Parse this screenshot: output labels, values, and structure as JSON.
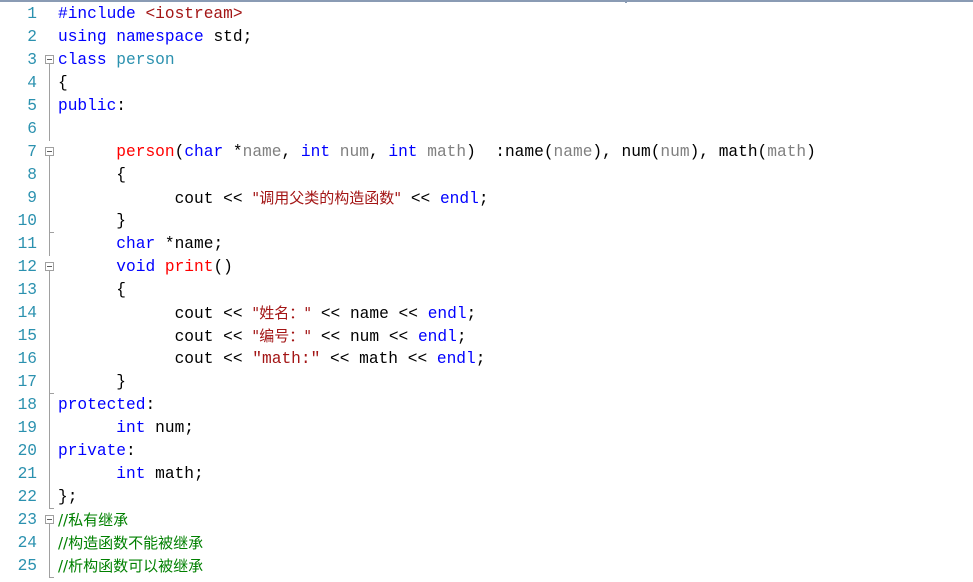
{
  "editor": {
    "lines": [
      {
        "n": "1",
        "tokens": [
          {
            "t": "#include ",
            "c": "kw"
          },
          {
            "t": "<iostream>",
            "c": "pp"
          }
        ]
      },
      {
        "n": "2",
        "tokens": [
          {
            "t": "using namespace ",
            "c": "kw"
          },
          {
            "t": "std;",
            "c": ""
          }
        ]
      },
      {
        "n": "3",
        "fold": "open",
        "tokens": [
          {
            "t": "class ",
            "c": "kw"
          },
          {
            "t": "person",
            "c": "ty"
          }
        ]
      },
      {
        "n": "4",
        "tokens": [
          {
            "t": "{",
            "c": ""
          }
        ]
      },
      {
        "n": "5",
        "tokens": [
          {
            "t": "public",
            "c": "kw"
          },
          {
            "t": ":",
            "c": ""
          }
        ]
      },
      {
        "n": "6",
        "tokens": []
      },
      {
        "n": "7",
        "fold": "open",
        "tokens": [
          {
            "t": "      ",
            "c": ""
          },
          {
            "t": "person",
            "c": "fn"
          },
          {
            "t": "(",
            "c": ""
          },
          {
            "t": "char",
            "c": "kw"
          },
          {
            "t": " *",
            "c": ""
          },
          {
            "t": "name",
            "c": "param"
          },
          {
            "t": ", ",
            "c": ""
          },
          {
            "t": "int",
            "c": "kw"
          },
          {
            "t": " ",
            "c": ""
          },
          {
            "t": "num",
            "c": "param"
          },
          {
            "t": ", ",
            "c": ""
          },
          {
            "t": "int",
            "c": "kw"
          },
          {
            "t": " ",
            "c": ""
          },
          {
            "t": "math",
            "c": "param"
          },
          {
            "t": ")  :name(",
            "c": ""
          },
          {
            "t": "name",
            "c": "param"
          },
          {
            "t": "), num(",
            "c": ""
          },
          {
            "t": "num",
            "c": "param"
          },
          {
            "t": "), math(",
            "c": ""
          },
          {
            "t": "math",
            "c": "param"
          },
          {
            "t": ")",
            "c": ""
          }
        ]
      },
      {
        "n": "8",
        "tokens": [
          {
            "t": "      {",
            "c": ""
          }
        ]
      },
      {
        "n": "9",
        "tokens": [
          {
            "t": "            cout << ",
            "c": ""
          },
          {
            "t": "\"调用父类的构造函数\"",
            "c": "str"
          },
          {
            "t": " << ",
            "c": ""
          },
          {
            "t": "endl",
            "c": "kw"
          },
          {
            "t": ";",
            "c": ""
          }
        ]
      },
      {
        "n": "10",
        "tokens": [
          {
            "t": "      }",
            "c": ""
          }
        ]
      },
      {
        "n": "11",
        "tokens": [
          {
            "t": "      ",
            "c": ""
          },
          {
            "t": "char",
            "c": "kw"
          },
          {
            "t": " *name;",
            "c": ""
          }
        ]
      },
      {
        "n": "12",
        "fold": "open",
        "tokens": [
          {
            "t": "      ",
            "c": ""
          },
          {
            "t": "void",
            "c": "kw"
          },
          {
            "t": " ",
            "c": ""
          },
          {
            "t": "print",
            "c": "fn"
          },
          {
            "t": "()",
            "c": ""
          }
        ]
      },
      {
        "n": "13",
        "tokens": [
          {
            "t": "      {",
            "c": ""
          }
        ]
      },
      {
        "n": "14",
        "tokens": [
          {
            "t": "            cout << ",
            "c": ""
          },
          {
            "t": "\"姓名：\"",
            "c": "str"
          },
          {
            "t": " << name << ",
            "c": ""
          },
          {
            "t": "endl",
            "c": "kw"
          },
          {
            "t": ";",
            "c": ""
          }
        ]
      },
      {
        "n": "15",
        "tokens": [
          {
            "t": "            cout << ",
            "c": ""
          },
          {
            "t": "\"编号：\"",
            "c": "str"
          },
          {
            "t": " << num << ",
            "c": ""
          },
          {
            "t": "endl",
            "c": "kw"
          },
          {
            "t": ";",
            "c": ""
          }
        ]
      },
      {
        "n": "16",
        "tokens": [
          {
            "t": "            cout << ",
            "c": ""
          },
          {
            "t": "\"math:\"",
            "c": "str"
          },
          {
            "t": " << math << ",
            "c": ""
          },
          {
            "t": "endl",
            "c": "kw"
          },
          {
            "t": ";",
            "c": ""
          }
        ]
      },
      {
        "n": "17",
        "tokens": [
          {
            "t": "      }",
            "c": ""
          }
        ]
      },
      {
        "n": "18",
        "tokens": [
          {
            "t": "protected",
            "c": "kw"
          },
          {
            "t": ":",
            "c": ""
          }
        ]
      },
      {
        "n": "19",
        "tokens": [
          {
            "t": "      ",
            "c": ""
          },
          {
            "t": "int",
            "c": "kw"
          },
          {
            "t": " num;",
            "c": ""
          }
        ]
      },
      {
        "n": "20",
        "tokens": [
          {
            "t": "private",
            "c": "kw"
          },
          {
            "t": ":",
            "c": ""
          }
        ]
      },
      {
        "n": "21",
        "tokens": [
          {
            "t": "      ",
            "c": ""
          },
          {
            "t": "int",
            "c": "kw"
          },
          {
            "t": " math;",
            "c": ""
          }
        ]
      },
      {
        "n": "22",
        "tokens": [
          {
            "t": "};",
            "c": ""
          }
        ]
      },
      {
        "n": "23",
        "fold": "open",
        "tokens": [
          {
            "t": "//私有继承",
            "c": "cm"
          }
        ]
      },
      {
        "n": "24",
        "tokens": [
          {
            "t": "//构造函数不能被继承",
            "c": "cm"
          }
        ]
      },
      {
        "n": "25",
        "tokens": [
          {
            "t": "//析构函数可以被继承",
            "c": "cm"
          }
        ]
      }
    ]
  }
}
